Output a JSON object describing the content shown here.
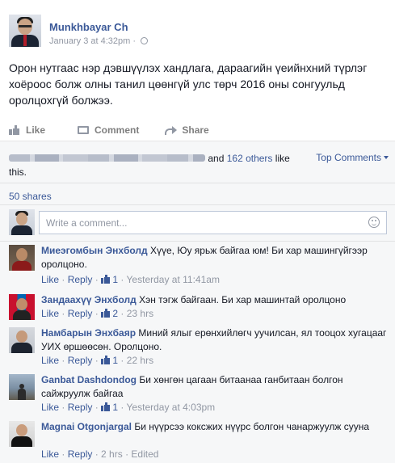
{
  "post": {
    "author": "Munkhbayar Ch",
    "timestamp": "January 3 at 4:32pm",
    "separator": "·",
    "text": "Орон нутгаас нэр дэвшүүлэх хандлага, дараагийн үеийнхний түрлэг хоёроос болж олны танил цөөнгүй улс төрч 2016 оны сонгуульд оролцохгүй болжээ.",
    "actions": {
      "like": "Like",
      "comment": "Comment",
      "share": "Share"
    }
  },
  "reactions": {
    "and_text": "and",
    "others_count": "162 others",
    "like_suffix": "like this.",
    "top_comments": "Top Comments"
  },
  "shares": "50 shares",
  "composer": {
    "placeholder": "Write a comment..."
  },
  "comments": [
    {
      "name": "Миеэгомбын Энхболд",
      "text": "Хүүе, Юу ярьж байгаа юм! Би хар машингүйгээр оролцоно.",
      "like": "Like",
      "reply": "Reply",
      "likes": "1",
      "time": "Yesterday at 11:41am"
    },
    {
      "name": "Зандаахүү Энхболд",
      "text": "Хэн тэгж байгаан. Би хар машинтай оролцоно",
      "like": "Like",
      "reply": "Reply",
      "likes": "2",
      "time": "23 hrs"
    },
    {
      "name": "Намбарын Энхбаяр",
      "text": "Миний ялыг ерөнхийлөгч уучилсан, ял тооцох хугацааг УИХ өршөөсөн. Оролцоно.",
      "like": "Like",
      "reply": "Reply",
      "likes": "1",
      "time": "22 hrs"
    },
    {
      "name": "Ganbat Dashdondog",
      "text": "Би хөнгөн цагаан битаанаа ганбитаан болгон сайжруулж байгаа",
      "like": "Like",
      "reply": "Reply",
      "likes": "1",
      "time": "Yesterday at 4:03pm"
    },
    {
      "name": "Magnai Otgonjargal",
      "text": "Би нүүрсээ коксжих нүүрс болгон чанаржуулж сууна",
      "like": "Like",
      "reply": "Reply",
      "time": "2 hrs",
      "edited": "Edited"
    }
  ],
  "colors": {
    "link": "#3b5998",
    "meta": "#9197a3",
    "feed_bg": "#f6f7f8"
  }
}
